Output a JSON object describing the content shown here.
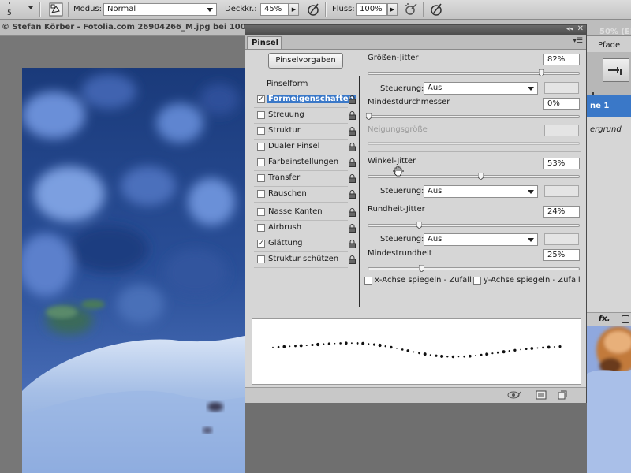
{
  "toolbar": {
    "brush_size": "5",
    "mode_label": "Modus:",
    "mode_value": "Normal",
    "opacity_label": "Deckkr.:",
    "opacity_value": "45%",
    "flow_label": "Fluss:",
    "flow_value": "100%"
  },
  "document": {
    "title": "© Stefan Körber - Fotolia.com 26904266_M.jpg bei 100%..."
  },
  "layers_fragment": {
    "title_fragment": "50% (Ebene",
    "tab_fragment": "Pfade",
    "layer1": "ne 1",
    "layer2": "ergrund",
    "fx": "fx."
  },
  "panel": {
    "tab": "Pinsel",
    "preset_button": "Pinselvorgaben",
    "list_header": "Pinselform",
    "list_items": [
      {
        "label": "Formeigenschaften",
        "checked": true,
        "selected": true
      },
      {
        "label": "Streuung",
        "checked": false
      },
      {
        "label": "Struktur",
        "checked": false
      },
      {
        "label": "Dualer Pinsel",
        "checked": false
      },
      {
        "label": "Farbeinstellungen",
        "checked": false
      },
      {
        "label": "Transfer",
        "checked": false
      },
      {
        "label": "Rauschen",
        "checked": false
      },
      {
        "label": "Nasse Kanten",
        "checked": false
      },
      {
        "label": "Airbrush",
        "checked": false
      },
      {
        "label": "Glättung",
        "checked": true
      },
      {
        "label": "Struktur schützen",
        "checked": false
      }
    ],
    "controls": {
      "size_jitter_label": "Größen-Jitter",
      "size_jitter_value": "82%",
      "size_control_label": "Steuerung:",
      "size_control_value": "Aus",
      "min_diameter_label": "Mindestdurchmesser",
      "min_diameter_value": "0%",
      "tilt_scale_label": "Neigungsgröße",
      "angle_jitter_label": "Winkel-Jitter",
      "angle_jitter_value": "53%",
      "angle_control_label": "Steuerung:",
      "angle_control_value": "Aus",
      "roundness_jitter_label": "Rundheit-Jitter",
      "roundness_jitter_value": "24%",
      "roundness_control_label": "Steuerung:",
      "roundness_control_value": "Aus",
      "min_roundness_label": "Mindestrundheit",
      "min_roundness_value": "25%",
      "flip_x_label": "x-Achse spiegeln - Zufall",
      "flip_y_label": "y-Achse spiegeln - Zufall"
    },
    "slider_levels": {
      "size_jitter": 0.82,
      "min_diameter": 0.0,
      "angle_jitter": 0.53,
      "roundness_jitter": 0.24,
      "min_roundness": 0.25
    }
  }
}
